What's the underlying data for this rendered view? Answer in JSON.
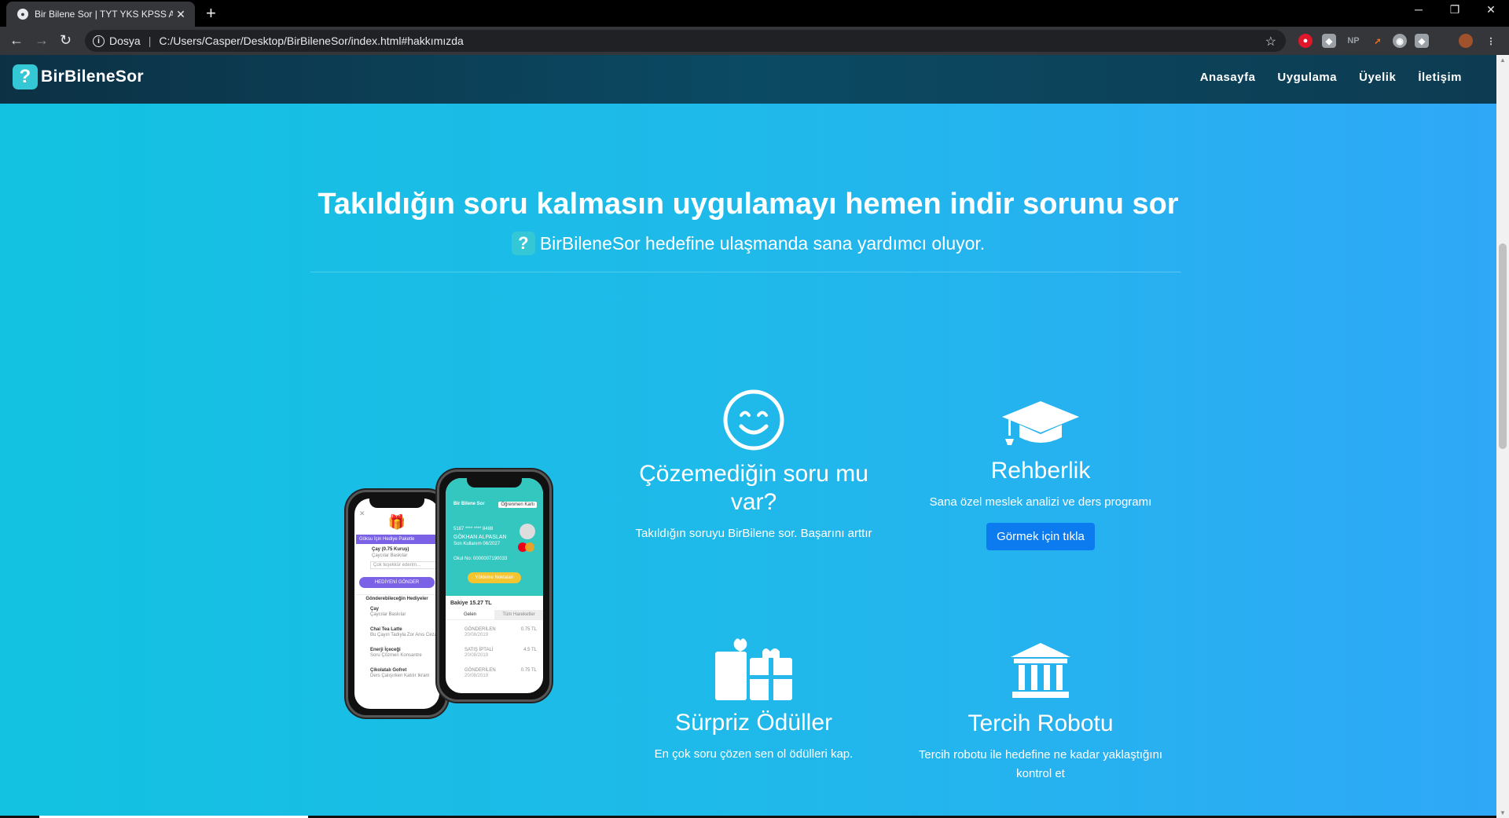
{
  "browser": {
    "tab_title": "Bir Bilene Sor | TYT YKS KPSS ALE",
    "new_tab": "+",
    "protocol_label": "Dosya",
    "url": "C:/Users/Casper/Desktop/BirBileneSor/index.html#hakkımızda",
    "extensions": [
      "NP"
    ]
  },
  "navbar": {
    "brand": "BirBileneSor",
    "links": [
      "Anasayfa",
      "Uygulama",
      "Üyelik",
      "İletişim"
    ]
  },
  "hero": {
    "title": "Takıldığın soru kalmasın uygulamayı hemen indir sorunu sor",
    "subtitle": "BirBileneSor hedefine ulaşmanda sana yardımcı oluyor."
  },
  "phone_left": {
    "gift_header": "Göksu İçin Hediye Paketle",
    "item1_title": "Çay (0.75 Kuruş)",
    "item1_sub": "Çaycılar Baskılar",
    "input_placeholder": "Çok teşekkür ederim...",
    "send_btn": "HEDİYENİ GÖNDER",
    "list_header": "Gönderebileceğin Hediyeler",
    "items": [
      {
        "title": "Çay",
        "sub": "Çaycılar Baskılar"
      },
      {
        "title": "Chai Tea Latte",
        "sub": "Bu Çayın Tadıyla Zor Anıs Cezal"
      },
      {
        "title": "Enerji İçeceği",
        "sub": "Soru Çözmen Konsantre"
      },
      {
        "title": "Çikolatalı Gofret",
        "sub": "Ders Çalışırken Katılır Ikram"
      }
    ]
  },
  "phone_right": {
    "card_tag": "Öğrenmen Kartı",
    "card_brand": "Bir Bilene Sor",
    "card_number": "5187 **** **** 8488",
    "card_name": "GÖKHAN ALPASLAN",
    "card_date": "Son Kullanım 06/2027",
    "card_school": "Okul No: 0000007190033",
    "load_btn": "Yükleme Noktaları",
    "balance": "Bakiye 15.27 TL",
    "tabs": [
      "Gelen",
      "Tüm Hareketler"
    ],
    "tx": [
      {
        "label": "GÖNDERİLEN",
        "date": "20/08/2019",
        "amount": "0.75 TL"
      },
      {
        "label": "SATIŞ İPTALİ",
        "date": "20/08/2019",
        "amount": "4.5 TL"
      },
      {
        "label": "GÖNDERİLEN",
        "date": "20/08/2019",
        "amount": "0.75 TL"
      }
    ]
  },
  "features": [
    {
      "title": "Çözemediğin soru mu var?",
      "text": "Takıldığın soruyu BirBilene sor. Başarını arttır",
      "icon": "smile-icon"
    },
    {
      "title": "Rehberlik",
      "text": "Sana özel meslek analizi ve ders programı",
      "button": "Görmek için tıkla",
      "icon": "graduation-cap-icon"
    },
    {
      "title": "Sürpriz Ödüller",
      "text": "En çok soru çözen sen ol ödülleri kap.",
      "icon": "gift-icon"
    },
    {
      "title": "Tercih Robotu",
      "text": "Tercih robotu ile hedefine ne kadar yaklaştığını kontrol et",
      "icon": "university-icon"
    }
  ]
}
